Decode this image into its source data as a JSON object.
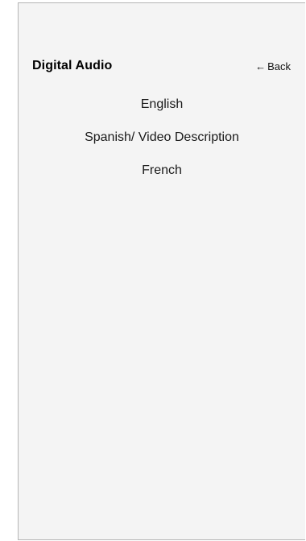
{
  "header": {
    "title": "Digital Audio",
    "back_arrow": "←",
    "back_label": "Back"
  },
  "options": [
    {
      "label": "English"
    },
    {
      "label": "Spanish/ Video Description"
    },
    {
      "label": "French"
    }
  ]
}
